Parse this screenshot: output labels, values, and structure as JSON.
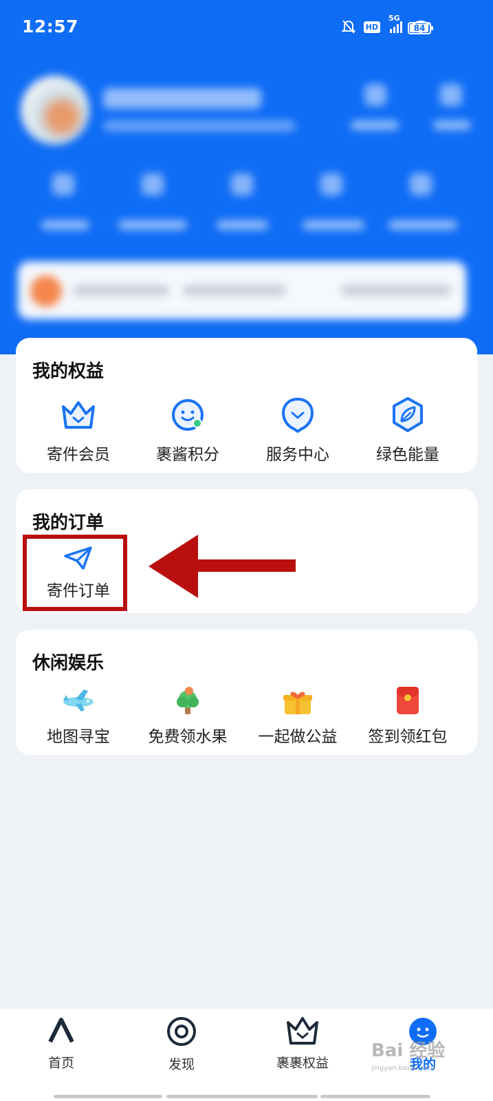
{
  "status_bar": {
    "time": "12:57",
    "network": "5G",
    "hd_label": "HD",
    "battery": "84"
  },
  "colors": {
    "brand_blue": "#0f6cf5",
    "highlight_red": "#b90f0f",
    "page_bg": "#eef2f7"
  },
  "rights_card": {
    "title": "我的权益",
    "items": [
      {
        "label": "寄件会员",
        "icon": "crown-icon"
      },
      {
        "label": "裹酱积分",
        "icon": "smiley-face-icon"
      },
      {
        "label": "服务中心",
        "icon": "service-chat-icon"
      },
      {
        "label": "绿色能量",
        "icon": "leaf-hexagon-icon"
      }
    ]
  },
  "orders_card": {
    "title": "我的订单",
    "items": [
      {
        "label": "寄件订单",
        "icon": "paper-plane-icon"
      }
    ]
  },
  "leisure_card": {
    "title": "休闲娱乐",
    "items": [
      {
        "label": "地图寻宝",
        "icon": "airplane-icon"
      },
      {
        "label": "免费领水果",
        "icon": "fruit-tree-icon"
      },
      {
        "label": "一起做公益",
        "icon": "gift-heart-icon"
      },
      {
        "label": "签到领红包",
        "icon": "red-envelope-icon"
      }
    ]
  },
  "bottom_nav": {
    "items": [
      {
        "label": "首页",
        "icon": "home-logo-icon",
        "active": false
      },
      {
        "label": "发现",
        "icon": "discover-ring-icon",
        "active": false
      },
      {
        "label": "裹裹权益",
        "icon": "crown-outline-icon",
        "active": false
      },
      {
        "label": "我的",
        "icon": "profile-face-icon",
        "active": true
      }
    ]
  },
  "watermark": {
    "text": "Bai 经验",
    "sub": "jingyan.baidu.com"
  }
}
